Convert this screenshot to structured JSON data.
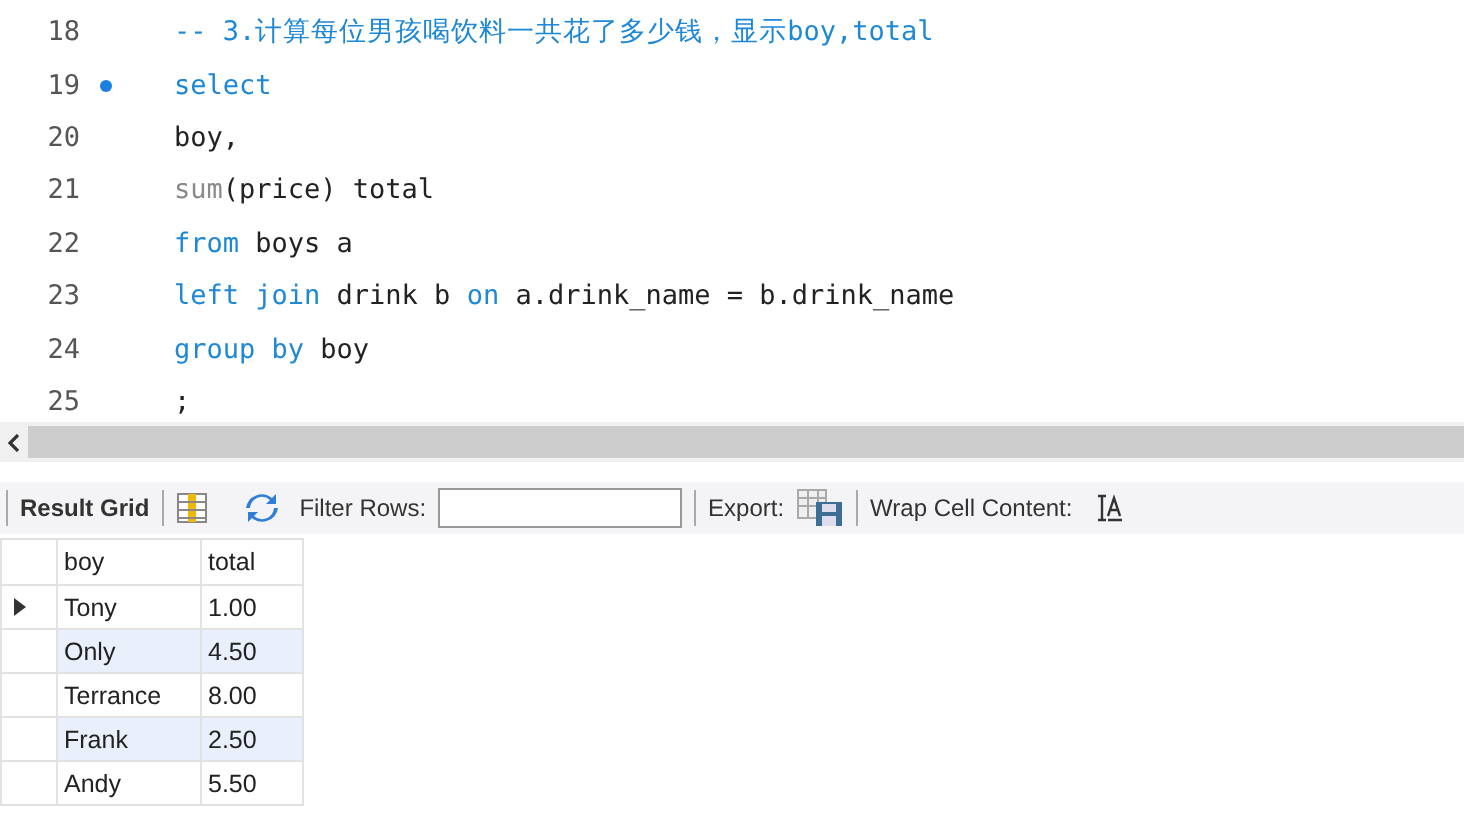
{
  "editor": {
    "lines": [
      {
        "number": "18",
        "marker": false,
        "tokens": [
          {
            "kind": "comment",
            "text": "-- 3.计算每位男孩喝饮料一共花了多少钱，显示boy,total"
          }
        ]
      },
      {
        "number": "19",
        "marker": true,
        "tokens": [
          {
            "kind": "keyword",
            "text": "select"
          }
        ]
      },
      {
        "number": "20",
        "marker": false,
        "tokens": [
          {
            "kind": "plain",
            "text": "boy,"
          }
        ]
      },
      {
        "number": "21",
        "marker": false,
        "tokens": [
          {
            "kind": "function",
            "text": "sum"
          },
          {
            "kind": "plain",
            "text": "(price) total"
          }
        ]
      },
      {
        "number": "22",
        "marker": false,
        "tokens": [
          {
            "kind": "keyword",
            "text": "from"
          },
          {
            "kind": "plain",
            "text": " boys a"
          }
        ]
      },
      {
        "number": "23",
        "marker": false,
        "tokens": [
          {
            "kind": "keyword",
            "text": "left join"
          },
          {
            "kind": "plain",
            "text": " drink b "
          },
          {
            "kind": "keyword",
            "text": "on"
          },
          {
            "kind": "plain",
            "text": " a.drink_name = b.drink_name"
          }
        ]
      },
      {
        "number": "24",
        "marker": false,
        "tokens": [
          {
            "kind": "keyword",
            "text": "group by"
          },
          {
            "kind": "plain",
            "text": " boy"
          }
        ]
      },
      {
        "number": "25",
        "marker": false,
        "tokens": [
          {
            "kind": "plain",
            "text": ";"
          }
        ]
      }
    ]
  },
  "toolbar": {
    "result_grid": "Result Grid",
    "filter_label": "Filter Rows:",
    "export_label": "Export:",
    "wrap_label": "Wrap Cell Content:"
  },
  "grid": {
    "columns": [
      "boy",
      "total"
    ],
    "rows": [
      {
        "selected": true,
        "cells": [
          "Tony",
          "1.00"
        ]
      },
      {
        "selected": false,
        "cells": [
          "Only",
          "4.50"
        ]
      },
      {
        "selected": false,
        "cells": [
          "Terrance",
          "8.00"
        ]
      },
      {
        "selected": false,
        "cells": [
          "Frank",
          "2.50"
        ]
      },
      {
        "selected": false,
        "cells": [
          "Andy",
          "5.50"
        ]
      }
    ]
  }
}
